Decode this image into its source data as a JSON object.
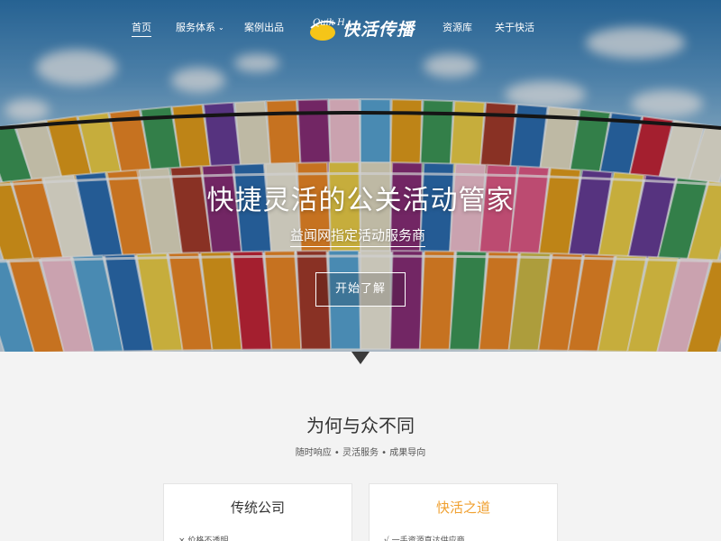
{
  "nav": {
    "home": "首页",
    "services": "服务体系",
    "cases": "案例出品",
    "logo_text": "快活传播",
    "logo_mark": "Quik Hot",
    "resources": "资源库",
    "about": "关于快活"
  },
  "hero": {
    "title": "快捷灵活的公关活动管家",
    "subtitle": "益闻网指定活动服务商",
    "cta": "开始了解"
  },
  "section": {
    "title": "为何与众不同",
    "subtitle": "随时响应 • 灵活服务 • 成果导向"
  },
  "cards": [
    {
      "title": "传统公司",
      "item": "× 价格不透明",
      "title_color": "#333333"
    },
    {
      "title": "快活之道",
      "item": "√ 一手资源直达供应商",
      "title_color": "#f0a030"
    }
  ],
  "colors": {
    "accent": "#f0a030",
    "logo_yellow": "#f5c518"
  }
}
